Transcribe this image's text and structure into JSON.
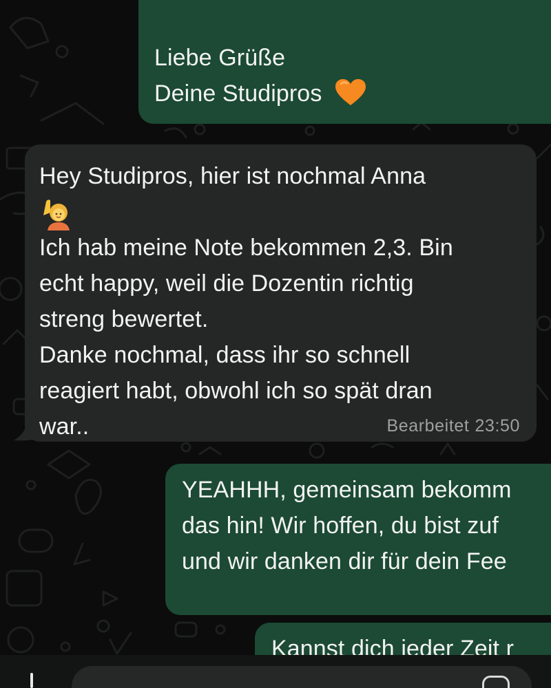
{
  "chat": {
    "messages": [
      {
        "direction": "outgoing",
        "lines": [
          "Liebe Grüße",
          "Deine Studipros"
        ],
        "emoji": "orange-heart"
      },
      {
        "direction": "incoming",
        "lines": [
          "Hey Studipros, hier ist nochmal Anna",
          "Ich hab meine Note bekommen 2,3. Bin",
          "echt happy, weil die Dozentin richtig",
          "streng bewertet.",
          "Danke nochmal, dass ihr so schnell",
          "reagiert habt, obwohl ich so spät dran",
          "war.."
        ],
        "emoji": "woman-raising-hand",
        "edited_label": "Bearbeitet",
        "time": "23:50"
      },
      {
        "direction": "outgoing",
        "lines": [
          "YEAHHH, gemeinsam bekomm",
          "das hin! Wir hoffen, du bist zuf",
          "und wir danken dir für dein Fee"
        ]
      },
      {
        "direction": "outgoing",
        "lines": [
          "Kannst dich jeder Zeit r"
        ]
      }
    ]
  },
  "colors": {
    "background": "#0b0c0b",
    "outgoing_bubble": "#1c4a34",
    "incoming_bubble": "#252626",
    "text": "#f2f3f2",
    "meta_text": "#9ca1a0"
  },
  "icons": [
    "plus-icon",
    "sticker-icon"
  ]
}
